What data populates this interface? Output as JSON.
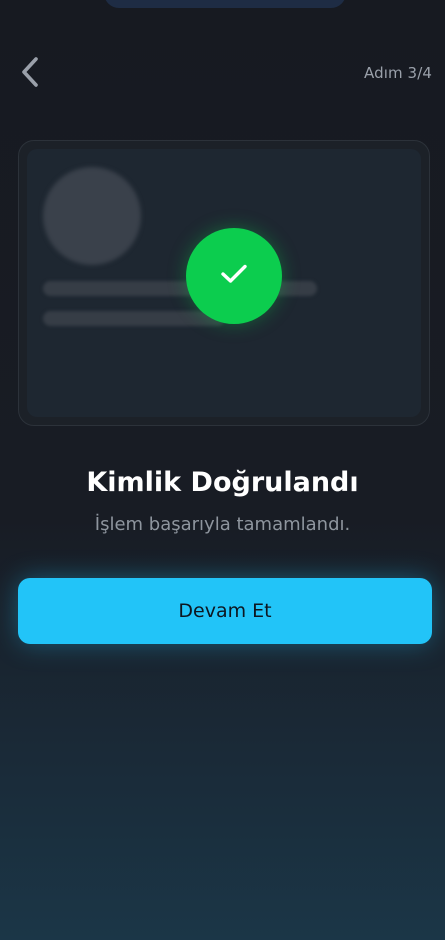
{
  "header": {
    "back_icon": "chevron-left-icon",
    "step_label": "Adım 3/4"
  },
  "card": {
    "status_icon": "check-icon",
    "status_color": "#0ccd4e"
  },
  "result": {
    "title": "Kimlik Doğrulandı",
    "subtitle": "İşlem başarıyla tamamlandı."
  },
  "actions": {
    "continue_label": "Devam Et",
    "accent_color": "#22c4f8"
  }
}
